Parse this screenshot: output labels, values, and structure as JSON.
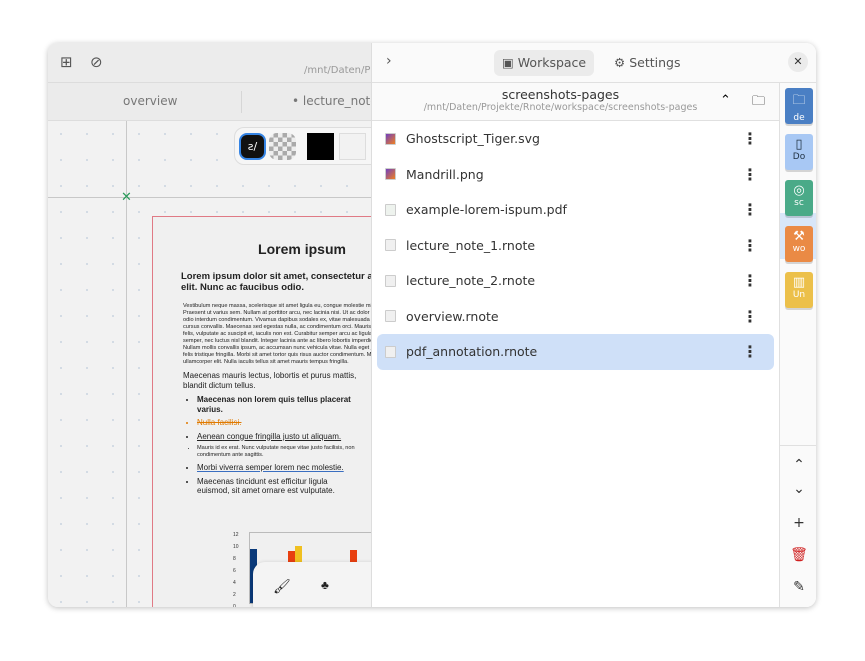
{
  "left": {
    "path": "/mnt/Daten/Projekte/Rnote/workspace/screenshots-pages",
    "tabs": [
      {
        "label": "overview"
      },
      {
        "label": "lecture_note"
      }
    ],
    "document": {
      "title": "Lorem ipsum",
      "subtitle": "Lorem ipsum dolor sit amet, consectetur adipiscing elit. Nunc ac faucibus odio.",
      "para1": "Vestibulum neque massa, scelerisque sit amet ligula eu, congue molestie mi. Praesent ut varius sem. Nullam at porttitor arcu, nec lacinia nisi. Ut ac dolor vitae odio interdum condimentum. Vivamus dapibus sodales ex, vitae malesuada ipsum cursus convallis. Maecenas sed egestas nulla, ac condimentum orci. Mauris diam felis, vulputate ac suscipit et, iaculis non est. Curabitur semper arcu ac ligula semper, nec luctus nisl blandit. Integer lacinia ante ac libero lobortis imperdiet. Nullam mollis convallis ipsum, ac accumsan nunc vehicula vitae. Nulla eget justo in felis tristique fringilla. Morbi sit amet tortor quis risus auctor condimentum. Morbi in ullamcorper elit. Nulla iaculis tellus sit amet mauris tempus fringilla.",
      "para2": "Maecenas mauris lectus, lobortis et purus mattis, blandit dictum tellus.",
      "bullets": [
        "Maecenas non lorem quis tellus placerat varius.",
        "Nulla facilisi.",
        "Aenean congue fringilla justo ut aliquam.",
        "Mauris id ex erat. Nunc vulputate neque vitae justo facilisis, non condimentum ante sagittis.",
        "Morbi viverra semper lorem nec molestie.",
        "Maecenas tincidunt est efficitur ligula euismod, sit amet ornare est vulputate."
      ],
      "chart_ticks": [
        "12",
        "10",
        "8",
        "6",
        "4",
        "2",
        "0"
      ]
    }
  },
  "panel": {
    "tabs": [
      {
        "label": "Workspace",
        "icon": "workspace-icon"
      },
      {
        "label": "Settings",
        "icon": "gear-icon"
      }
    ],
    "dir_name": "screenshots-pages",
    "dir_path": "/mnt/Daten/Projekte/Rnote/workspace/screenshots-pages",
    "files": [
      {
        "name": "Ghostscript_Tiger.svg",
        "type": "image"
      },
      {
        "name": "Mandrill.png",
        "type": "image"
      },
      {
        "name": "example-lorem-ispum.pdf",
        "type": "pdf"
      },
      {
        "name": "lecture_note_1.rnote",
        "type": "file"
      },
      {
        "name": "lecture_note_2.rnote",
        "type": "file"
      },
      {
        "name": "overview.rnote",
        "type": "file"
      },
      {
        "name": "pdf_annotation.rnote",
        "type": "file",
        "selected": true
      }
    ],
    "workspaces": [
      {
        "label": "de",
        "icon": "folder-icon",
        "color": "#4a7fc4"
      },
      {
        "label": "Do",
        "icon": "bookmark-icon",
        "color": "#a8c8f4"
      },
      {
        "label": "sc",
        "icon": "camera-icon",
        "color": "#4aaa88"
      },
      {
        "label": "wo",
        "icon": "hammer-icon",
        "color": "#ea8a45"
      },
      {
        "label": "Un",
        "icon": "book-icon",
        "color": "#ecc04a"
      }
    ]
  }
}
